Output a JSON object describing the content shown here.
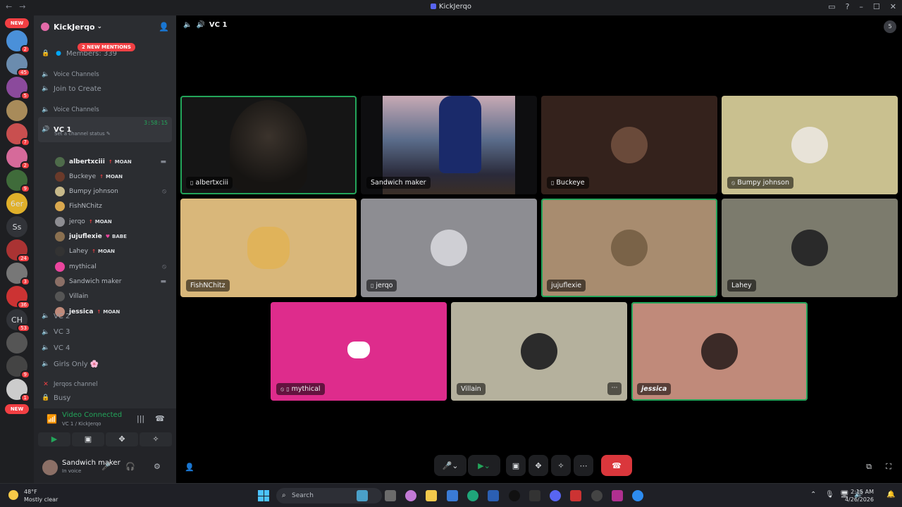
{
  "window": {
    "title": "KickJerqo",
    "back": "←",
    "forward": "→",
    "inbox_icon": "inbox-icon",
    "help": "?",
    "min": "–",
    "max": "☐",
    "close": "✕"
  },
  "guilds": {
    "new_top": "NEW",
    "new_bottom": "NEW",
    "items": [
      {
        "badge": "2",
        "color": "#4a90d9",
        "text": ""
      },
      {
        "badge": "45",
        "color": "#6b8cae",
        "text": ""
      },
      {
        "badge": "5",
        "color": "#8b4a9c",
        "text": ""
      },
      {
        "badge": "",
        "color": "#a88b5a",
        "text": ""
      },
      {
        "badge": "7",
        "color": "#c94f4f",
        "text": ""
      },
      {
        "badge": "2",
        "color": "#d66a9a",
        "text": ""
      },
      {
        "badge": "9",
        "color": "#3f6b3a",
        "text": ""
      },
      {
        "badge": "",
        "color": "#e0b02a",
        "text": "6er"
      },
      {
        "badge": "",
        "color": "#313338",
        "text": "Ss"
      },
      {
        "badge": "24",
        "color": "#a33",
        "text": ""
      },
      {
        "badge": "3",
        "color": "#777",
        "text": ""
      },
      {
        "badge": "36",
        "color": "#c33",
        "text": ""
      },
      {
        "badge": "53",
        "color": "#313338",
        "text": "CH"
      },
      {
        "badge": "",
        "color": "#555",
        "text": ""
      },
      {
        "badge": "9",
        "color": "#444",
        "text": ""
      },
      {
        "badge": "1",
        "color": "#ccc",
        "text": ""
      }
    ]
  },
  "server": {
    "name": "KickJerqo",
    "chevron": "⌄",
    "mentions": "2 NEW MENTIONS",
    "members": "Members: 339"
  },
  "sidebar": {
    "cat_voice_1": "Voice Channels",
    "join_create": "Join to Create",
    "cat_voice_2": "Voice Channels",
    "vc1": {
      "name": "VC 1",
      "timer": "3:58:15",
      "status": "Set a channel status ✎"
    },
    "members": [
      {
        "name": "albertxciii",
        "bold": true,
        "tag": "MOAN",
        "dot": "↑",
        "right": "▬",
        "color": "#4e6b4a"
      },
      {
        "name": "Buckeye",
        "bold": false,
        "tag": "MOAN",
        "dot": "↑",
        "right": "",
        "color": "#6a3a2a"
      },
      {
        "name": "Bumpy johnson",
        "bold": false,
        "tag": "",
        "dot": "",
        "right": "⦸",
        "color": "#c7b98a"
      },
      {
        "name": "FishNChitz",
        "bold": false,
        "tag": "",
        "dot": "",
        "right": "",
        "color": "#d9a84e"
      },
      {
        "name": "jerqo",
        "bold": false,
        "tag": "MOAN",
        "dot": "↑",
        "right": "",
        "color": "#8d8d92"
      },
      {
        "name": "jujuflexie",
        "bold": true,
        "tag": "BABE",
        "dot": "♥",
        "right": "",
        "color": "#8a7050"
      },
      {
        "name": "Lahey",
        "bold": false,
        "tag": "MOAN",
        "dot": "↑",
        "right": "",
        "color": "#333"
      },
      {
        "name": "mythical",
        "bold": false,
        "tag": "",
        "dot": "",
        "right": "⦸",
        "color": "#eb459e"
      },
      {
        "name": "Sandwich maker",
        "bold": false,
        "tag": "",
        "dot": "",
        "right": "▬",
        "color": "#8b6f66"
      },
      {
        "name": "Villain",
        "bold": false,
        "tag": "",
        "dot": "",
        "right": "",
        "color": "#555"
      },
      {
        "name": "jessica",
        "bold": true,
        "tag": "MOAN",
        "dot": "↑",
        "right": "",
        "color": "#c08a7a"
      }
    ],
    "other_vcs": [
      "VC 2",
      "VC 3",
      "VC 4",
      "Girls Only 🌸"
    ],
    "cat_jerqos": "Jerqos channel",
    "busy": "Busy"
  },
  "voice_panel": {
    "title": "Video Connected",
    "subtitle": "VC 1 / KickJerqo"
  },
  "user": {
    "name": "Sandwich maker",
    "status": "In voice"
  },
  "stage": {
    "channel": "VC 1",
    "activity_count": "5",
    "tiles": [
      {
        "name": "albertxciii",
        "phone": true,
        "muted": false,
        "bg": "#151515",
        "avatar": "",
        "speaking": true,
        "row": 0,
        "col": 0
      },
      {
        "name": "Sandwich maker",
        "phone": false,
        "muted": false,
        "bg": "#0e0e10",
        "avatar": "",
        "speaking": false,
        "row": 0,
        "col": 1
      },
      {
        "name": "Buckeye",
        "phone": true,
        "muted": false,
        "bg": "#34221c",
        "avatar": "#6a4a3a",
        "speaking": false,
        "row": 0,
        "col": 2
      },
      {
        "name": "Bumpy johnson",
        "phone": false,
        "muted": true,
        "bg": "#c9c08f",
        "avatar": "#e8e3d8",
        "speaking": false,
        "row": 0,
        "col": 3
      },
      {
        "name": "FishNChitz",
        "phone": false,
        "muted": false,
        "bg": "#d9b77a",
        "avatar": "#e0b35a",
        "speaking": false,
        "row": 1,
        "col": 0
      },
      {
        "name": "jerqo",
        "phone": true,
        "muted": false,
        "bg": "#8d8d92",
        "avatar": "#cfcfd4",
        "speaking": false,
        "row": 1,
        "col": 1
      },
      {
        "name": "jujuflexie",
        "phone": false,
        "muted": false,
        "bg": "#a88c6f",
        "avatar": "#7a6348",
        "speaking": true,
        "row": 1,
        "col": 2
      },
      {
        "name": "Lahey",
        "phone": false,
        "muted": false,
        "bg": "#7c7b6d",
        "avatar": "#2a2a2a",
        "speaking": false,
        "row": 1,
        "col": 3
      },
      {
        "name": "mythical",
        "phone": true,
        "muted": true,
        "bg": "#de2c8c",
        "avatar": "",
        "speaking": false,
        "row": 2,
        "col": 0
      },
      {
        "name": "Villain",
        "phone": false,
        "muted": false,
        "bg": "#b5b19d",
        "avatar": "#2b2b2b",
        "speaking": false,
        "row": 2,
        "col": 1
      },
      {
        "name": "jessica",
        "phone": false,
        "muted": false,
        "bg": "#c08a7a",
        "avatar": "#3b2a27",
        "speaking": true,
        "row": 2,
        "col": 2
      }
    ]
  },
  "controls": {
    "more": "⋯"
  },
  "taskbar": {
    "weather_temp": "48°F",
    "weather_desc": "Mostly clear",
    "search_placeholder": "Search",
    "time": "2:15 AM",
    "date": "4/26/2026"
  }
}
